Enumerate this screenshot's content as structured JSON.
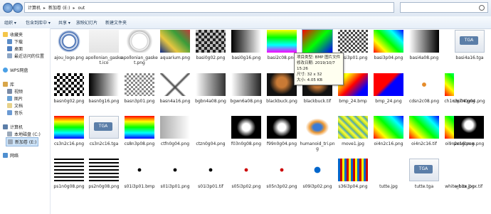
{
  "address_bar": {
    "crumbs": [
      "计算机",
      "新加卷 (E:)",
      "out"
    ]
  },
  "toolbar": {
    "organize": "组织 ▾",
    "include": "包含到库中 ▾",
    "share": "共享 ▾",
    "slideshow": "放映幻灯片",
    "new_folder": "新建文件夹"
  },
  "sidebar": {
    "favorites": "收藏夹",
    "downloads": "下载",
    "desktop": "桌面",
    "recent": "最近访问的位置",
    "wps": "WPS网盘",
    "libraries": "库",
    "videos": "视频",
    "pictures": "图片",
    "documents": "文档",
    "music": "音乐",
    "computer": "计算机",
    "local_disk": "本地磁盘 (C:)",
    "new_volume": "新加卷 (E:)",
    "network": "网络"
  },
  "tooltip": {
    "line1": "项目类型: BMP 图片文件",
    "line2": "修改日期: 2019/10/7 15:26",
    "line3": "尺寸: 32 x 32",
    "line4": "大小: 4.05 KB"
  },
  "files": [
    {
      "name": "ajou_logo.png"
    },
    {
      "name": "apollonian_gasket.ico"
    },
    {
      "name": "apollonian_gasket.png"
    },
    {
      "name": "aquarium.png"
    },
    {
      "name": "basi0g02.png"
    },
    {
      "name": "basi0g16.png"
    },
    {
      "name": "basi2c08.png"
    },
    {
      "name": "basi2c16.png"
    },
    {
      "name": "basi3p01.png"
    },
    {
      "name": "basi3p04.png"
    },
    {
      "name": "basi4a08.png"
    },
    {
      "name": "basi4a16.tga"
    },
    {
      "name": "basn0g02.png"
    },
    {
      "name": "basn0g16.png"
    },
    {
      "name": "basn3p01.png"
    },
    {
      "name": "basn4a16.png"
    },
    {
      "name": "bgbn4a08.png"
    },
    {
      "name": "bgwn6a08.png"
    },
    {
      "name": "blackbuck.png"
    },
    {
      "name": "blackbuck.tif"
    },
    {
      "name": "bmp_24.bmp"
    },
    {
      "name": "bmp_24.png"
    },
    {
      "name": "cdsn2c08.png"
    },
    {
      "name": "ch1n3p04.png"
    },
    {
      "name": "cm7n0g04.png"
    },
    {
      "name": "cs3n2c16.png"
    },
    {
      "name": "cs3n2c16.tga"
    },
    {
      "name": "cs8n3p08.png"
    },
    {
      "name": "ctfn0g04.png"
    },
    {
      "name": "ctzn0g04.png"
    },
    {
      "name": "f03n0g08.png"
    },
    {
      "name": "f99n0g04.png"
    },
    {
      "name": "humanoid_tri.png"
    },
    {
      "name": "move1.jpg"
    },
    {
      "name": "oi4n2c16.png"
    },
    {
      "name": "oi4n2c16.tif"
    },
    {
      "name": "oi9n2c16.png"
    },
    {
      "name": "pengbrew.png"
    },
    {
      "name": "ps1n0g08.png"
    },
    {
      "name": "ps2n0g08.png"
    },
    {
      "name": "s01i3p01.bmp"
    },
    {
      "name": "s01i3p01.png"
    },
    {
      "name": "s01i3p01.tif"
    },
    {
      "name": "s05i3p02.png"
    },
    {
      "name": "s05n3p02.png"
    },
    {
      "name": "s09i3p02.png"
    },
    {
      "name": "s36i3p04.png"
    },
    {
      "name": "tutte.jpg"
    },
    {
      "name": "tutte.tga"
    },
    {
      "name": "white_box.jpg"
    },
    {
      "name": "white_box.tif"
    }
  ],
  "tga_badge": "TGA",
  "colors": {
    "selection": "#cde3f8",
    "link": "#1e3957"
  }
}
